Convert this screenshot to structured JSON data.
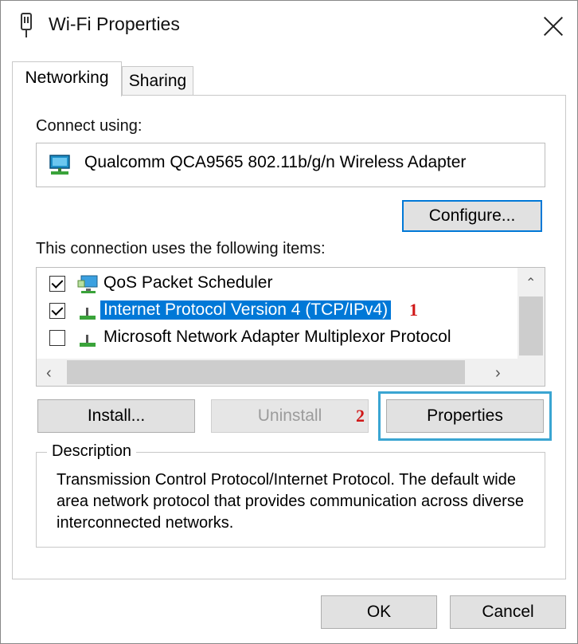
{
  "window": {
    "title": "Wi-Fi Properties"
  },
  "tabs": [
    {
      "label": "Networking",
      "active": true
    },
    {
      "label": "Sharing",
      "active": false
    }
  ],
  "connect_using": {
    "label": "Connect using:",
    "adapter_name": "Qualcomm QCA9565 802.11b/g/n Wireless Adapter",
    "configure_button": "Configure..."
  },
  "items": {
    "label": "This connection uses the following items:",
    "list": [
      {
        "label": "QoS Packet Scheduler",
        "checked": true,
        "selected": false
      },
      {
        "label": "Internet Protocol Version 4 (TCP/IPv4)",
        "checked": true,
        "selected": true
      },
      {
        "label": "Microsoft Network Adapter Multiplexor Protocol",
        "checked": false,
        "selected": false
      }
    ]
  },
  "annotations": {
    "step1": "1",
    "step2": "2"
  },
  "buttons": {
    "install": "Install...",
    "uninstall": "Uninstall",
    "properties": "Properties",
    "ok": "OK",
    "cancel": "Cancel"
  },
  "description": {
    "legend": "Description",
    "text": "Transmission Control Protocol/Internet Protocol. The default wide area network protocol that provides communication across diverse interconnected networks."
  },
  "colors": {
    "accent": "#0078d7",
    "highlight_box": "#3aa5d2",
    "annotation": "#d01818"
  },
  "icons": {
    "title": "network-adapter-icon",
    "adapter": "network-monitor-icon",
    "item_qos": "network-service-icon",
    "item_protocol": "network-protocol-icon"
  }
}
